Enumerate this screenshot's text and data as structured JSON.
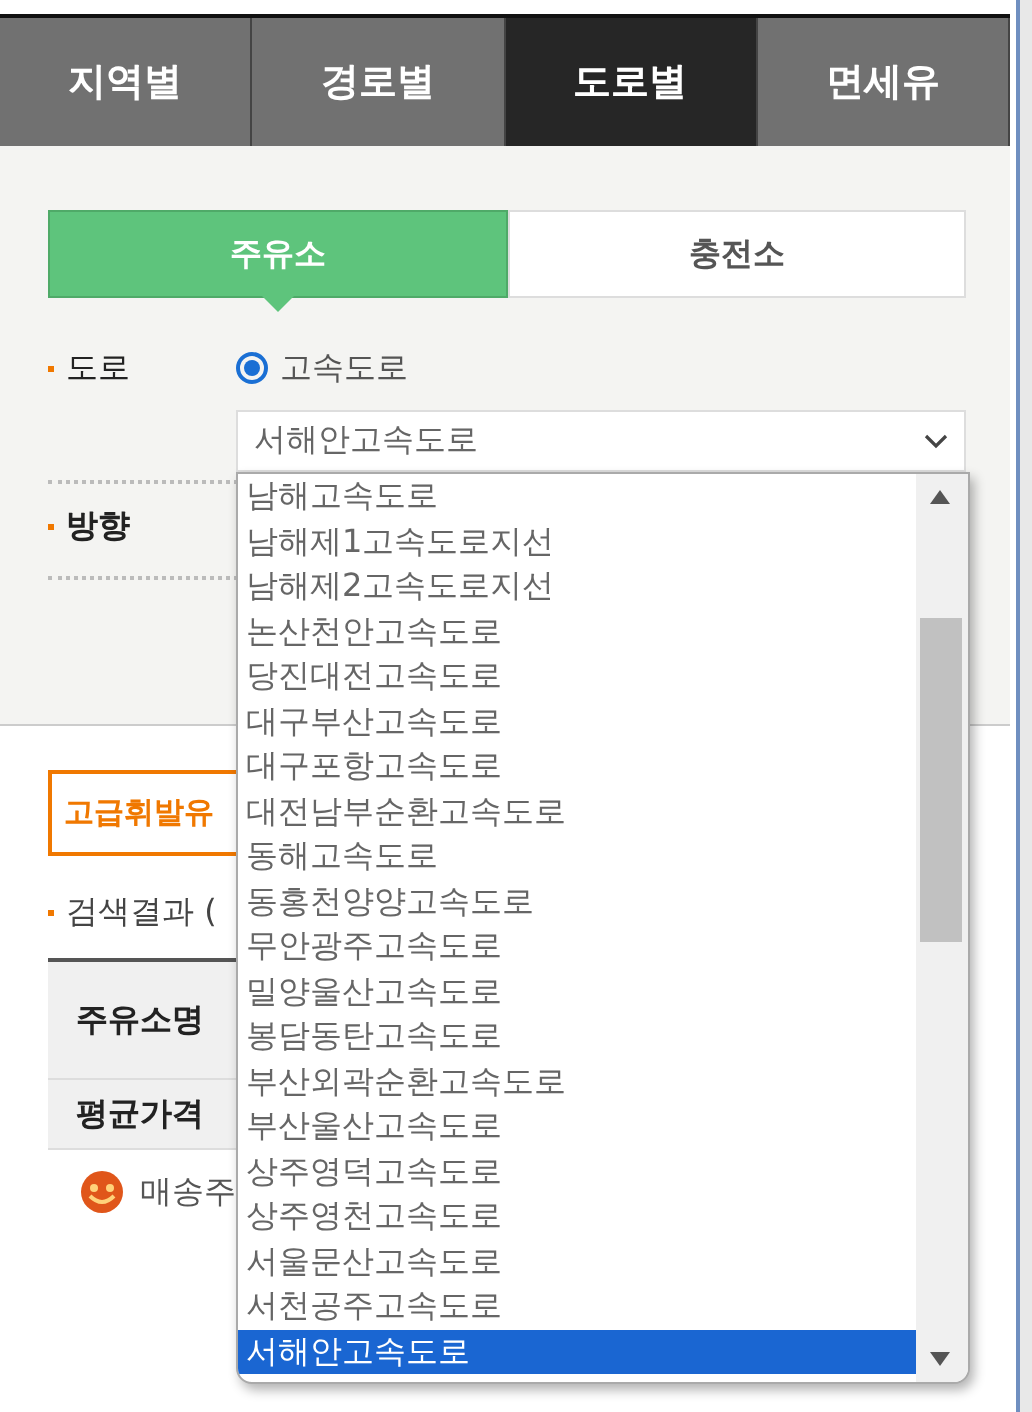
{
  "tabs": [
    {
      "label": "지역별",
      "selected": false
    },
    {
      "label": "경로별",
      "selected": false
    },
    {
      "label": "도로별",
      "selected": true
    },
    {
      "label": "면세유",
      "selected": false
    }
  ],
  "station_tabs": [
    {
      "label": "주유소",
      "selected": true
    },
    {
      "label": "충전소",
      "selected": false
    }
  ],
  "road": {
    "label": "도로",
    "radio": {
      "label": "고속도로",
      "selected": true
    },
    "select_value": "서해안고속도로"
  },
  "direction": {
    "label": "방향"
  },
  "fuel_tab": {
    "label": "고급휘발유"
  },
  "results": {
    "label": "검색결과 ("
  },
  "table": {
    "rows": [
      {
        "header": "주유소명"
      },
      {
        "header": "평균가격"
      }
    ]
  },
  "station_row": {
    "name": "매송주"
  },
  "dropdown": {
    "options": [
      {
        "label": "남해고속도로",
        "selected": false
      },
      {
        "label": "남해제1고속도로지선",
        "selected": false
      },
      {
        "label": "남해제2고속도로지선",
        "selected": false
      },
      {
        "label": "논산천안고속도로",
        "selected": false
      },
      {
        "label": "당진대전고속도로",
        "selected": false
      },
      {
        "label": "대구부산고속도로",
        "selected": false
      },
      {
        "label": "대구포항고속도로",
        "selected": false
      },
      {
        "label": "대전남부순환고속도로",
        "selected": false
      },
      {
        "label": "동해고속도로",
        "selected": false
      },
      {
        "label": "동홍천양양고속도로",
        "selected": false
      },
      {
        "label": "무안광주고속도로",
        "selected": false
      },
      {
        "label": "밀양울산고속도로",
        "selected": false
      },
      {
        "label": "봉담동탄고속도로",
        "selected": false
      },
      {
        "label": "부산외곽순환고속도로",
        "selected": false
      },
      {
        "label": "부산울산고속도로",
        "selected": false
      },
      {
        "label": "상주영덕고속도로",
        "selected": false
      },
      {
        "label": "상주영천고속도로",
        "selected": false
      },
      {
        "label": "서울문산고속도로",
        "selected": false
      },
      {
        "label": "서천공주고속도로",
        "selected": false
      },
      {
        "label": "서해안고속도로",
        "selected": true
      }
    ]
  }
}
